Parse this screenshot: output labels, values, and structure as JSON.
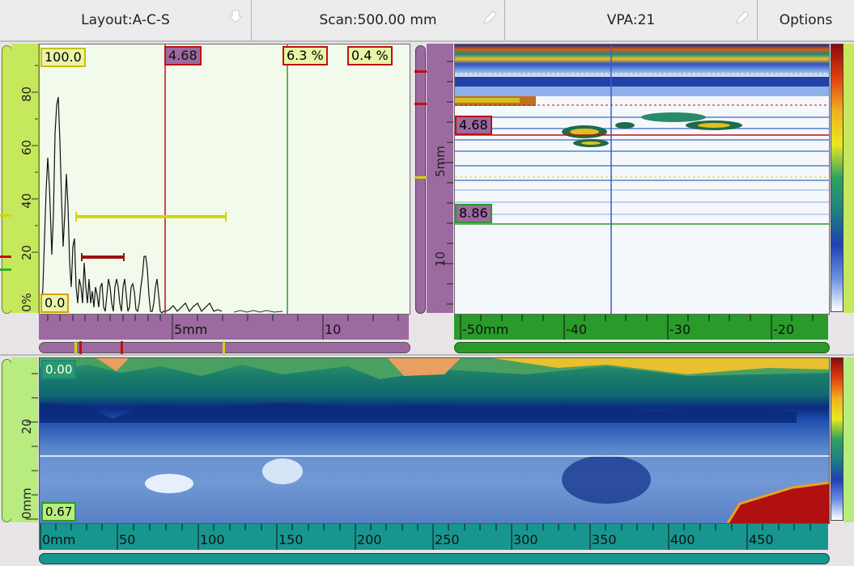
{
  "toolbar": {
    "layout_label": "Layout:A-C-S",
    "scan_label": "Scan:500.00 mm",
    "vpa_label": "VPA:21",
    "options_label": "Options"
  },
  "ascan": {
    "amp_top": "100.0",
    "amp_bottom": "0.0",
    "gate_pos": "4.68",
    "readout_1": "6.3 %",
    "readout_2": "0.4 %",
    "y_ticks": [
      "80",
      "60",
      "40",
      "20",
      "0%"
    ],
    "x_ticks": [
      "5mm",
      "10"
    ]
  },
  "sscan": {
    "cursor_1": "4.68",
    "cursor_2": "8.86",
    "depth_ticks": [
      "5mm",
      "10"
    ],
    "x_ticks": [
      "-50mm",
      "-40",
      "-30",
      "-20"
    ]
  },
  "cscan": {
    "top_label": "0.00",
    "bottom_label": "0.67",
    "y_ticks": [
      "20",
      "0mm"
    ],
    "x_ticks": [
      "0mm",
      "50",
      "100",
      "150",
      "200",
      "250",
      "300",
      "350",
      "400",
      "450"
    ]
  },
  "colors": {
    "green_rail": "#c5e85d",
    "purple_axis": "#9c6aa0",
    "green_axis": "#2a9b2a",
    "teal_axis": "#17968f",
    "gate_yellow": "#d4d40a",
    "gate_red": "#c01010"
  }
}
